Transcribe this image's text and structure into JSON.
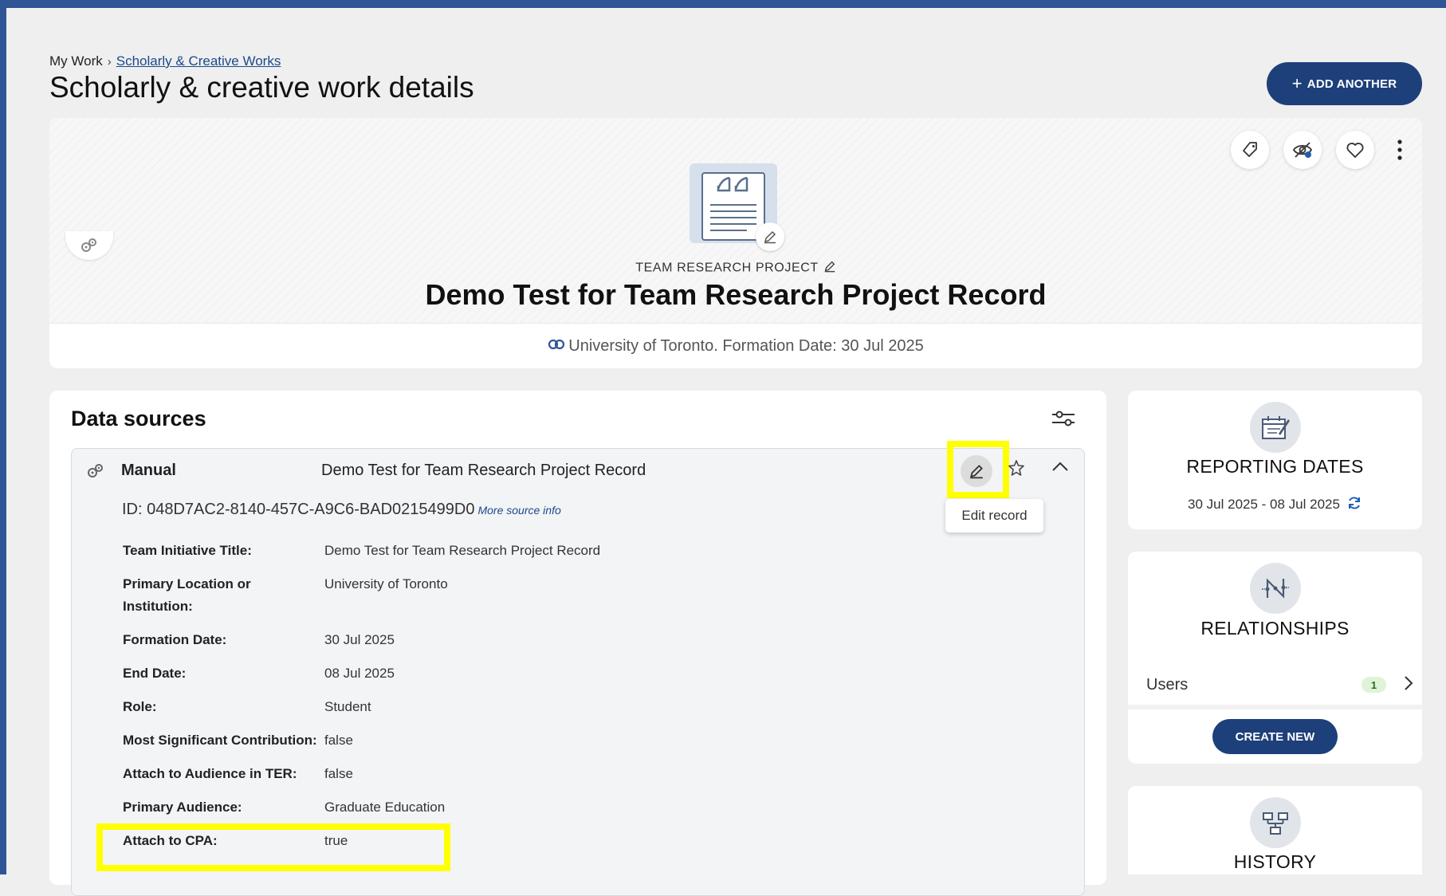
{
  "breadcrumb": {
    "root": "My Work",
    "current": "Scholarly & Creative Works"
  },
  "page": {
    "title": "Scholarly & creative work details"
  },
  "header": {
    "add_another_label": "ADD ANOTHER"
  },
  "hero": {
    "type_label": "TEAM RESEARCH PROJECT",
    "title": "Demo Test for Team Research Project Record",
    "meta": "University of Toronto. Formation Date: 30 Jul 2025"
  },
  "data_sources": {
    "heading": "Data sources",
    "source": {
      "name": "Manual",
      "title": "Demo Test for Team Research Project Record",
      "id_text": "ID: 048D7AC2-8140-457C-A9C6-BAD0215499D0",
      "more_info": "More source info",
      "edit_tooltip": "Edit record",
      "fields": [
        {
          "label": "Team Initiative Title:",
          "value": "Demo Test for Team Research Project Record"
        },
        {
          "label": "Primary Location or Institution:",
          "value": "University of Toronto"
        },
        {
          "label": "Formation Date:",
          "value": "30 Jul 2025"
        },
        {
          "label": "End Date:",
          "value": "08 Jul 2025"
        },
        {
          "label": "Role:",
          "value": "Student"
        },
        {
          "label": "Most Significant Contribution:",
          "value": "false"
        },
        {
          "label": "Attach to Audience in TER:",
          "value": "false"
        },
        {
          "label": "Primary Audience:",
          "value": "Graduate Education"
        },
        {
          "label": "Attach to CPA:",
          "value": "true"
        }
      ]
    }
  },
  "sidebar": {
    "reporting": {
      "title": "REPORTING DATES",
      "range": "30 Jul 2025 - 08 Jul 2025"
    },
    "relationships": {
      "title": "RELATIONSHIPS",
      "users_label": "Users",
      "users_count": "1",
      "create_label": "CREATE NEW"
    },
    "history": {
      "title": "HISTORY"
    }
  },
  "colors": {
    "primary": "#1d3f7a",
    "highlight": "#ffff00",
    "frame": "#2f5597"
  }
}
